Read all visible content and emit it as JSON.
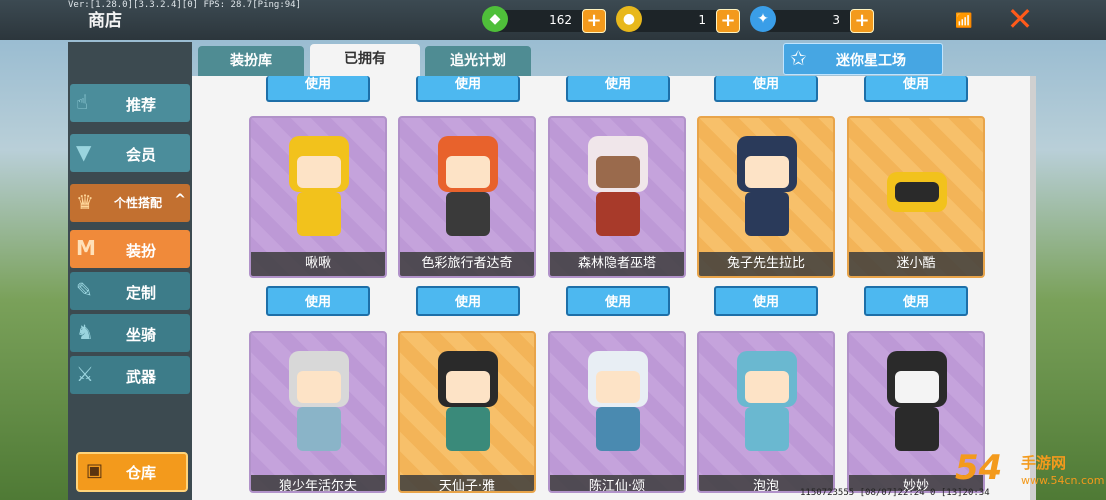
{
  "debug_text": "Ver:[1.28.0][3.3.2.4][0] FPS: 28.7[Ping:94]",
  "shop_title": "商店",
  "currencies": [
    {
      "icon": "green-gem-icon",
      "value": "162",
      "color": "#4fbf3a"
    },
    {
      "icon": "gold-coin-icon",
      "value": "1",
      "color": "#e8b81c"
    },
    {
      "icon": "blue-star-coin-icon",
      "value": "3",
      "color": "#3a9ee8"
    }
  ],
  "plus_label": "+",
  "close_label": "✕",
  "sidebar": {
    "items": [
      {
        "label": "推荐",
        "icon": "thumbs-up-icon",
        "glyph": "👍"
      },
      {
        "label": "会员",
        "icon": "vip-icon",
        "glyph": "▲"
      },
      {
        "label": "个性搭配",
        "icon": "trophy-icon",
        "glyph": "♛"
      },
      {
        "label": "装扮",
        "icon": "outfit-icon",
        "glyph": "M"
      },
      {
        "label": "定制",
        "icon": "pencil-icon",
        "glyph": "✎"
      },
      {
        "label": "坐骑",
        "icon": "mount-icon",
        "glyph": "♞"
      },
      {
        "label": "武器",
        "icon": "gun-icon",
        "glyph": "⚔"
      }
    ],
    "group_arrow": "^",
    "storage_label": "仓库",
    "storage_icon": "chest-icon"
  },
  "tabs": [
    {
      "label": "装扮库"
    },
    {
      "label": "已拥有"
    },
    {
      "label": "追光计划"
    }
  ],
  "studio_label": "迷你星工场",
  "use_label": "使用",
  "row1": [
    {
      "name": "啾啾",
      "theme": "purple"
    },
    {
      "name": "色彩旅行者达奇",
      "theme": "purple"
    },
    {
      "name": "森林隐者巫塔",
      "theme": "purple"
    },
    {
      "name": "兔子先生拉比",
      "theme": "orange"
    },
    {
      "name": "迷小酷",
      "theme": "orange"
    }
  ],
  "row2": [
    {
      "name": "狼少年活尔夫",
      "theme": "purple"
    },
    {
      "name": "天仙子·雅",
      "theme": "orange"
    },
    {
      "name": "陈江仙·颂",
      "theme": "purple"
    },
    {
      "name": "泡泡",
      "theme": "purple"
    },
    {
      "name": "妙妙",
      "theme": "purple"
    }
  ],
  "footer_text": "1150723555    [08/07]22:24 0  [13]20:34",
  "watermark": {
    "num": "54",
    "brand": "手游网",
    "url": "www.54cn.com"
  }
}
